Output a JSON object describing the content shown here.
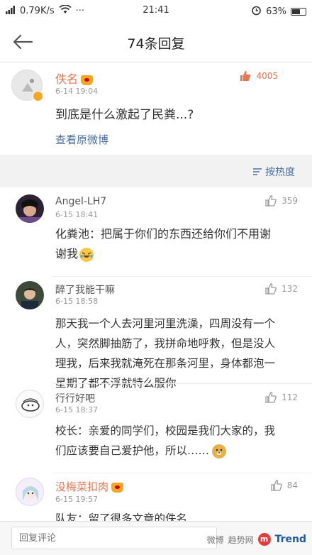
{
  "status_bar": {
    "speed": "0.79K/s",
    "time": "21:41",
    "battery": "63%",
    "battery_level": 0.63
  },
  "nav": {
    "title": "74条回复"
  },
  "post": {
    "username": "佚名",
    "timestamp": "6-14 19:04",
    "likes": "4005",
    "text": "到底是什么激起了民粪...?",
    "view_original": "查看原微博"
  },
  "sort_label": "按热度",
  "comments": [
    {
      "username": "Angel-LH7",
      "timestamp": "6-15 18:41",
      "likes": "359",
      "text_line1": "化粪池：把属于你们的东西还给你们不用谢",
      "text_line2": "谢我"
    },
    {
      "username": "醉了我能干嘛",
      "timestamp": "6-15 18:58",
      "likes": "132",
      "text_line1": "那天我一个人去河里河里洗澡，四周没有一个",
      "text_line2": "人，突然脚抽筋了，我拼命地呼救，但是没人",
      "text_line3": "理我，后来我就淹死在那条河里，身体都泡一",
      "text_line4": "星期了都不浮就特么服你"
    },
    {
      "username": "行行好吧",
      "timestamp": "6-15 18:37",
      "likes": "112",
      "text_line1": "校长：亲爱的同学们，校园是我们大家的，我",
      "text_line2": "们应该要自己爱护他，所以……"
    },
    {
      "username": "没梅菜扣肉",
      "timestamp": "6-15 19:57",
      "likes": "84",
      "text_line1": "队友：留了很多文章的佚名"
    }
  ],
  "input": {
    "placeholder": "回复评论"
  },
  "watermark": {
    "weibo": "微博",
    "cn": "趋势网",
    "en": "Trend"
  }
}
